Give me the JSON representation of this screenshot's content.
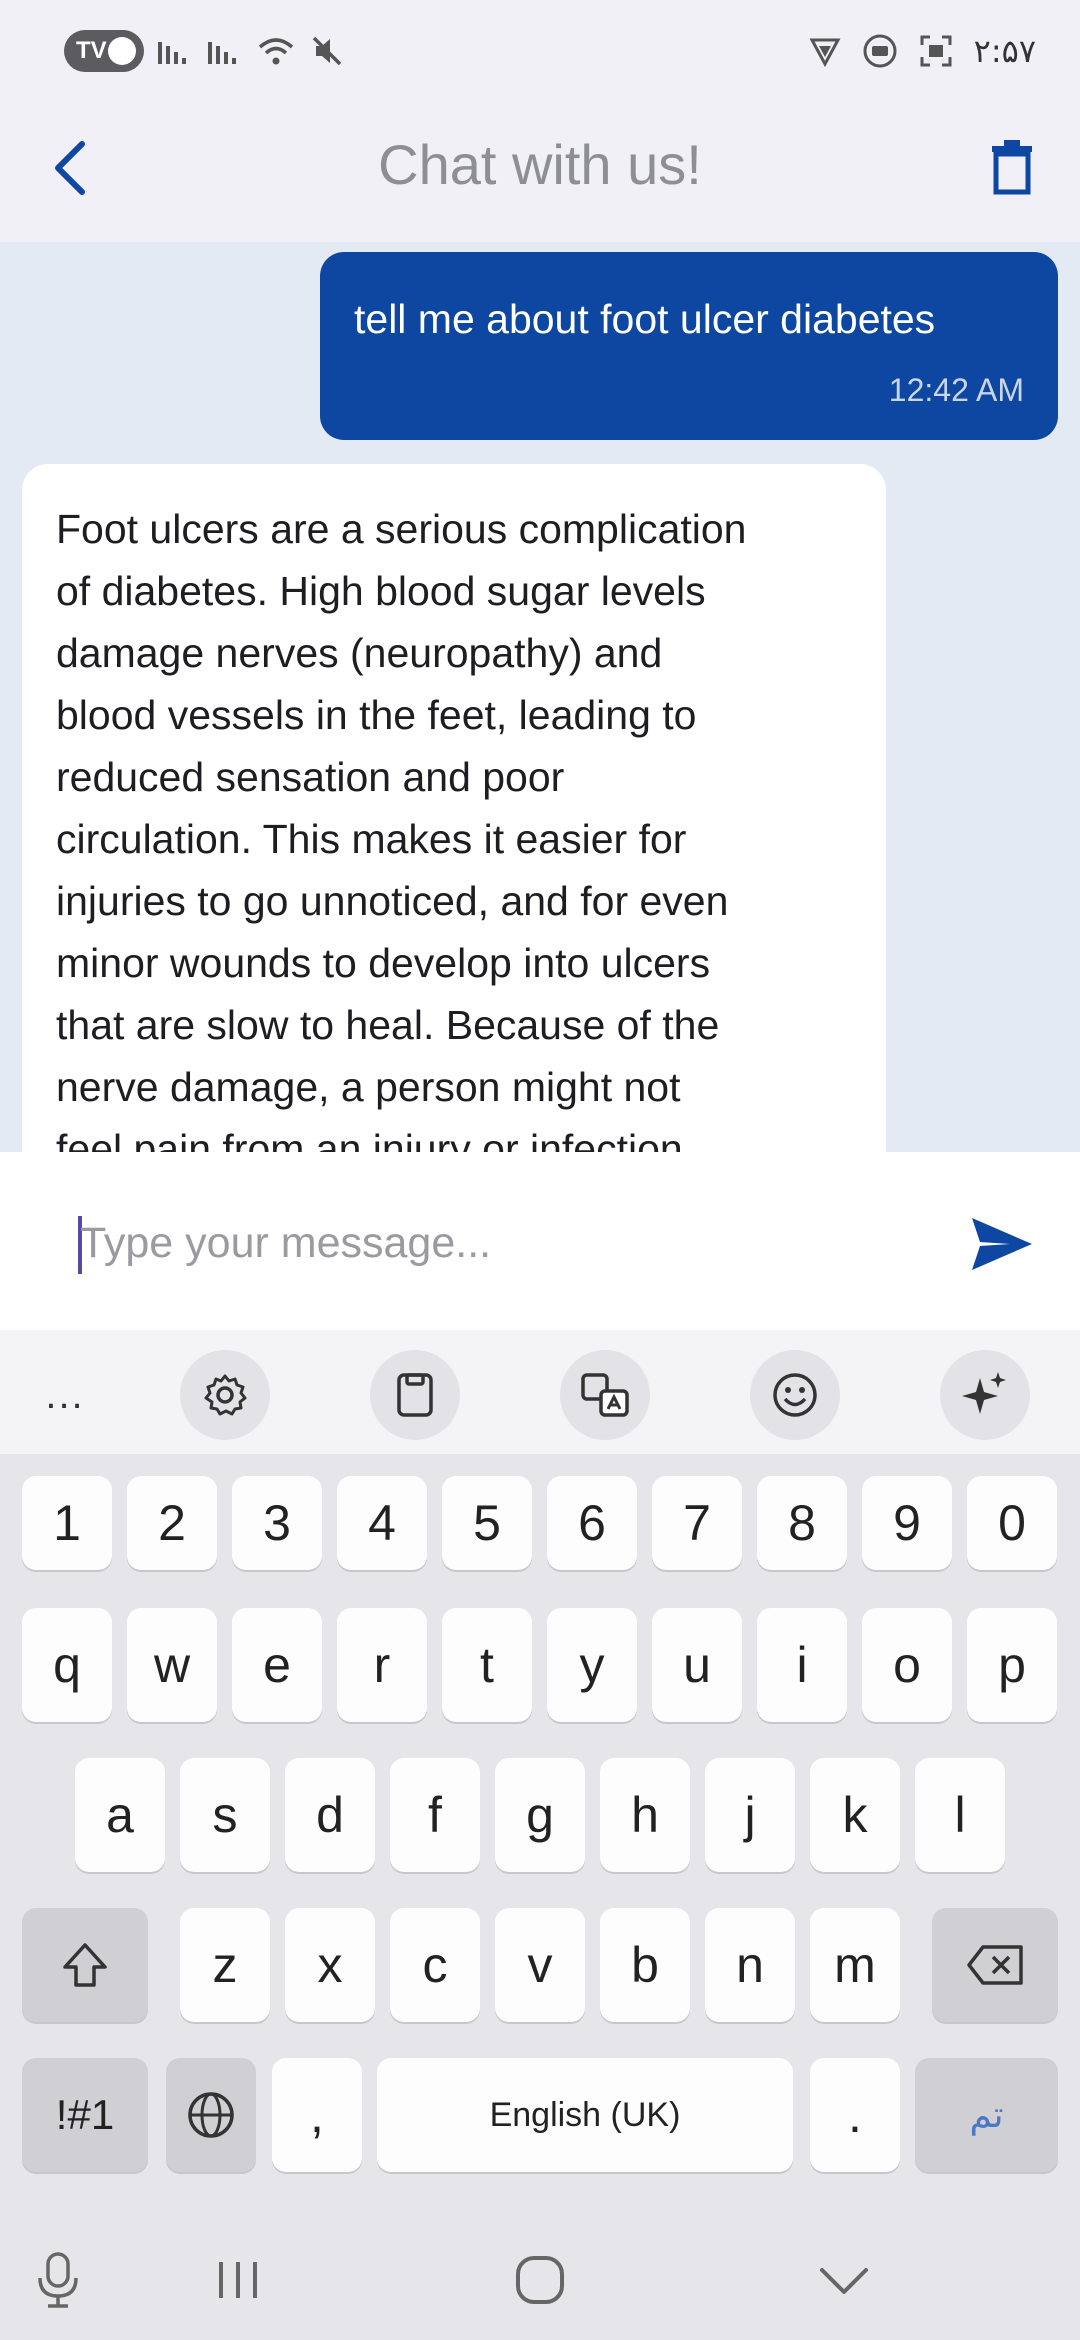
{
  "status_bar": {
    "pill_label": "TV",
    "time": "۲:۵۷",
    "icons": [
      "signal-icon",
      "signal-icon",
      "wifi-icon",
      "mute-icon",
      "vpn-icon",
      "record-icon",
      "screenshot-icon"
    ]
  },
  "header": {
    "title": "Chat with us!",
    "back_icon": "back-arrow-icon",
    "delete_icon": "trash-icon"
  },
  "messages": [
    {
      "sender": "user",
      "text": "tell me about foot ulcer diabetes",
      "time": "12:42 AM"
    },
    {
      "sender": "bot",
      "text": "Foot ulcers are a serious complication\nof diabetes.  High blood sugar levels\ndamage nerves (neuropathy) and\nblood vessels in the feet, leading to\nreduced sensation and poor\ncirculation.  This makes it easier for\ninjuries to go unnoticed, and for even\nminor wounds to develop into ulcers\nthat are slow to heal.  Because of the\nnerve damage, a person might not\nfeel pain from an injury or infection,"
    }
  ],
  "input": {
    "placeholder": "Type your message...",
    "value": ""
  },
  "keyboard": {
    "toolbar": [
      "more-icon",
      "settings-icon",
      "clipboard-icon",
      "translate-icon",
      "emoji-icon",
      "ai-sparkle-icon"
    ],
    "toolbar_more_label": "...",
    "row_numbers": [
      "1",
      "2",
      "3",
      "4",
      "5",
      "6",
      "7",
      "8",
      "9",
      "0"
    ],
    "row_1": [
      "q",
      "w",
      "e",
      "r",
      "t",
      "y",
      "u",
      "i",
      "o",
      "p"
    ],
    "row_2": [
      "a",
      "s",
      "d",
      "f",
      "g",
      "h",
      "j",
      "k",
      "l"
    ],
    "row_3": [
      "z",
      "x",
      "c",
      "v",
      "b",
      "n",
      "m"
    ],
    "symbols_label": "!#1",
    "comma_label": ",",
    "space_label": "English (UK)",
    "period_label": ".",
    "done_label": "تم"
  },
  "colors": {
    "accent": "#0d47a1",
    "chat_bg": "#e3eaf3",
    "bot_bubble": "#ffffff",
    "header_title": "#8e8e95"
  }
}
